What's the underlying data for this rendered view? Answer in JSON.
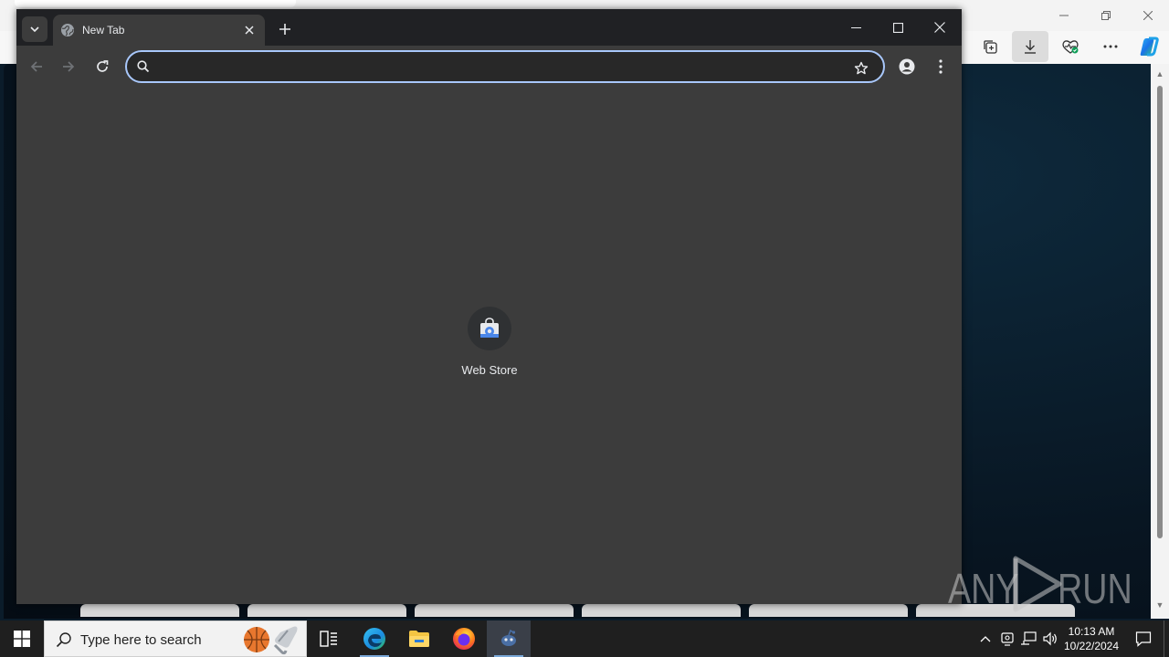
{
  "chrome": {
    "tab_title": "New Tab",
    "omnibox_value": "",
    "shortcut_label": "Web Store"
  },
  "taskbar": {
    "search_placeholder": "Type here to search",
    "clock_time": "10:13 AM",
    "clock_date": "10/22/2024"
  },
  "watermark": {
    "left": "ANY",
    "right": "RUN"
  },
  "icons": {
    "chrome_tab_search": "chevron-down-icon",
    "chrome_favicon": "globe-icon",
    "chrome_tab_close": "close-icon",
    "chrome_new_tab": "plus-icon",
    "chrome_minimize": "minimize-icon",
    "chrome_maximize": "maximize-icon",
    "chrome_close": "close-icon",
    "chrome_back": "arrow-left-icon",
    "chrome_forward": "arrow-right-icon",
    "chrome_reload": "reload-icon",
    "chrome_search": "search-icon",
    "chrome_bookmark": "star-icon",
    "chrome_profile": "person-icon",
    "chrome_menu": "kebab-menu-icon",
    "shortcut": "web-store-icon",
    "edge_collections": "collections-icon",
    "edge_downloads": "download-icon",
    "edge_heartbeat": "browser-essentials-icon",
    "edge_more": "more-icon",
    "edge_copilot": "copilot-icon",
    "edge_popup_search": "search-icon",
    "edge_popup_more": "more-icon",
    "edge_popup_pin": "pin-icon",
    "start": "windows-logo-icon",
    "taskbar_search": "search-icon",
    "task_view": "task-view-icon",
    "edge_app": "edge-icon",
    "explorer_app": "folder-icon",
    "firefox_app": "firefox-icon",
    "active_app": "app-icon",
    "tray_chevron": "chevron-up-icon",
    "tray_meet": "meet-icon",
    "tray_network": "network-icon",
    "tray_volume": "volume-icon",
    "notification": "notification-icon"
  },
  "colors": {
    "chrome_frame": "#202124",
    "chrome_toolbar": "#3c3c3c",
    "omnibox_focus_ring": "#a8c7fa",
    "taskbar": "#1f1f1f"
  }
}
